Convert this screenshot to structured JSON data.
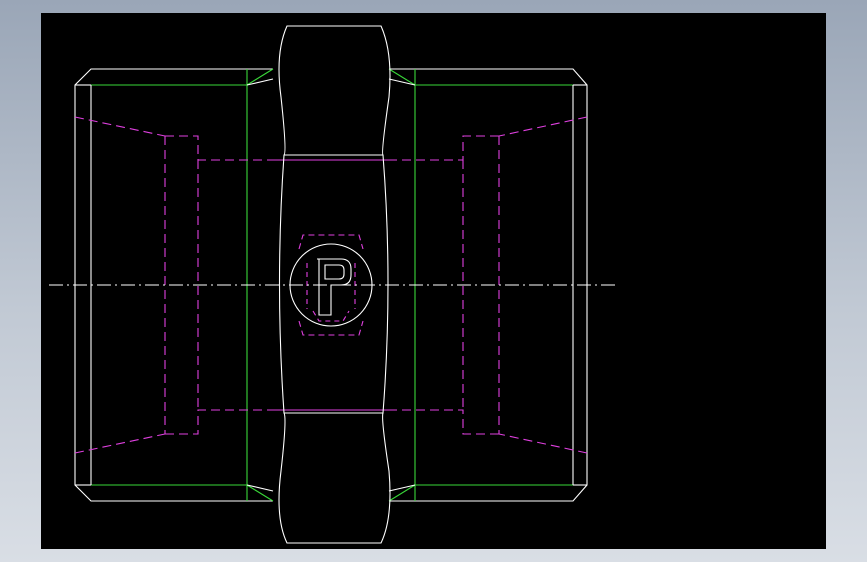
{
  "window": {
    "background_top": "#9aa6b7",
    "background_bottom": "#d9dee5"
  },
  "viewport": {
    "background": "#000000"
  },
  "colors": {
    "visible_edges": "#ffffff",
    "tangent_edges": "#39d839",
    "hidden_edges": "#e040e0"
  },
  "drawing": {
    "part": "hex-nipple-fitting",
    "view": "front",
    "logo": {
      "glyph": "P",
      "icon": "circle-p-logo-icon"
    }
  }
}
